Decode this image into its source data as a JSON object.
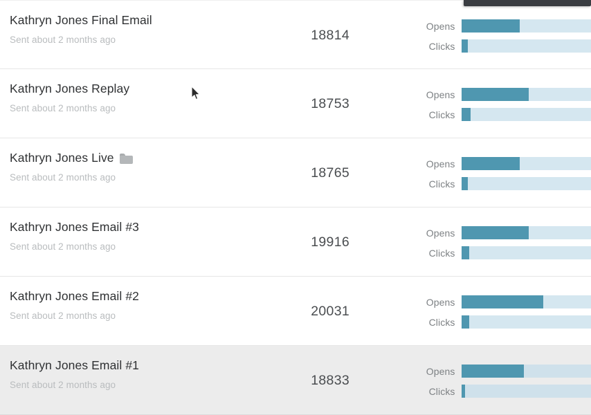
{
  "colors": {
    "bar_fill": "#4f97b0",
    "bar_track": "#d5e7f0",
    "title_text": "#2f3133",
    "subtitle_text": "#b9bcbe",
    "number_text": "#4a4d50",
    "stat_label_text": "#7d8184",
    "selected_row_bg": "#ececec",
    "top_strip": "#3a3d42"
  },
  "stat_labels": {
    "opens": "Opens",
    "clicks": "Clicks"
  },
  "campaigns": [
    {
      "title": "Kathryn Jones Final Email",
      "subtitle": "Sent about 2 months ago",
      "count": "18814",
      "has_folder_icon": false,
      "selected": false,
      "opens_pct": 45,
      "clicks_pct": 5
    },
    {
      "title": "Kathryn Jones Replay",
      "subtitle": "Sent about 2 months ago",
      "count": "18753",
      "has_folder_icon": false,
      "selected": false,
      "opens_pct": 52,
      "clicks_pct": 7
    },
    {
      "title": "Kathryn Jones Live",
      "subtitle": "Sent about 2 months ago",
      "count": "18765",
      "has_folder_icon": true,
      "selected": false,
      "opens_pct": 45,
      "clicks_pct": 5
    },
    {
      "title": "Kathryn Jones Email #3",
      "subtitle": "Sent about 2 months ago",
      "count": "19916",
      "has_folder_icon": false,
      "selected": false,
      "opens_pct": 52,
      "clicks_pct": 6
    },
    {
      "title": "Kathryn Jones Email #2",
      "subtitle": "Sent about 2 months ago",
      "count": "20031",
      "has_folder_icon": false,
      "selected": false,
      "opens_pct": 63,
      "clicks_pct": 6
    },
    {
      "title": "Kathryn Jones Email #1",
      "subtitle": "Sent about 2 months ago",
      "count": "18833",
      "has_folder_icon": false,
      "selected": true,
      "opens_pct": 48,
      "clicks_pct": 3
    }
  ]
}
